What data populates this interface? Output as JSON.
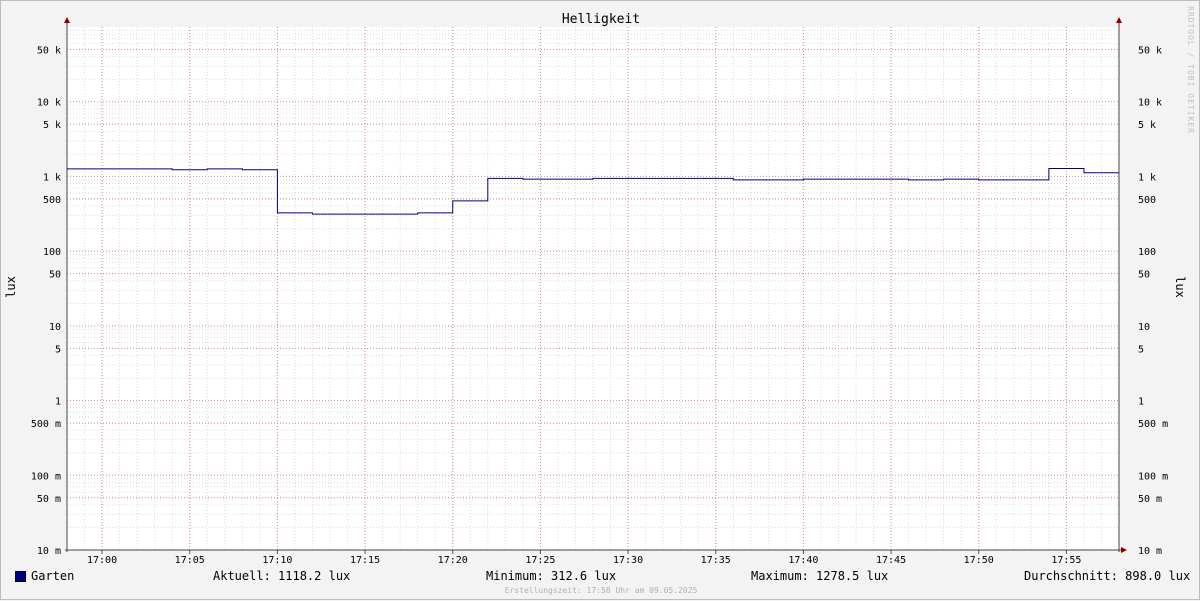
{
  "chart_data": {
    "type": "line",
    "title": "Helligkeit",
    "ylabel": "lux",
    "yscale": "log",
    "ylim": [
      0.01,
      100000
    ],
    "x_labels": [
      "17:00",
      "17:05",
      "17:10",
      "17:15",
      "17:20",
      "17:25",
      "17:30",
      "17:35",
      "17:40",
      "17:45",
      "17:50",
      "17:55"
    ],
    "y_ticks": [
      {
        "value": 50000,
        "label": "50 k"
      },
      {
        "value": 10000,
        "label": "10 k"
      },
      {
        "value": 5000,
        "label": "5 k"
      },
      {
        "value": 1000,
        "label": "1 k"
      },
      {
        "value": 500,
        "label": "500"
      },
      {
        "value": 100,
        "label": "100"
      },
      {
        "value": 50,
        "label": "50"
      },
      {
        "value": 10,
        "label": "10"
      },
      {
        "value": 5,
        "label": "5"
      },
      {
        "value": 1,
        "label": "1"
      },
      {
        "value": 0.5,
        "label": "500 m"
      },
      {
        "value": 0.1,
        "label": "100 m"
      },
      {
        "value": 0.05,
        "label": "50 m"
      },
      {
        "value": 0.01,
        "label": "10 m"
      }
    ],
    "series": [
      {
        "name": "Garten",
        "color": "#00008b",
        "step": true,
        "points": [
          [
            "16:58",
            1260
          ],
          [
            "17:04",
            1230
          ],
          [
            "17:06",
            1260
          ],
          [
            "17:08",
            1230
          ],
          [
            "17:10",
            325
          ],
          [
            "17:12",
            312.6
          ],
          [
            "17:18",
            325
          ],
          [
            "17:20",
            470
          ],
          [
            "17:22",
            940
          ],
          [
            "17:24",
            920
          ],
          [
            "17:28",
            940
          ],
          [
            "17:36",
            900
          ],
          [
            "17:40",
            920
          ],
          [
            "17:46",
            900
          ],
          [
            "17:48",
            920
          ],
          [
            "17:50",
            900
          ],
          [
            "17:54",
            1278.5
          ],
          [
            "17:56",
            1118.2
          ],
          [
            "17:58",
            1118.2
          ]
        ]
      }
    ],
    "grid": true,
    "legend_position": "bottom"
  },
  "legend": {
    "series_name": "Garten",
    "current": "Aktuell: 1118.2 lux",
    "minimum": "Minimum: 312.6 lux",
    "maximum": "Maximum: 1278.5 lux",
    "average": "Durchschnitt: 898.0 lux"
  },
  "footer": "Erstellungszeit: 17:58 Uhr am 09.05.2025",
  "watermark": "RRDTOOL / TOBI OETIKER"
}
